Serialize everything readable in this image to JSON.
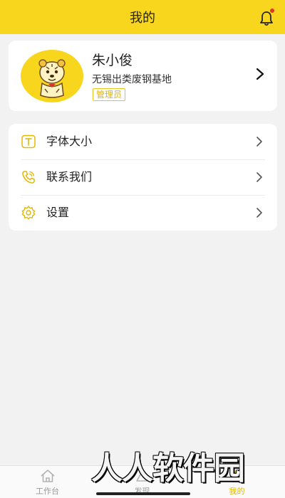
{
  "header": {
    "title": "我的",
    "bell_icon": "bell-icon",
    "accent": "#f8d61e",
    "notification_color": "#e3342f"
  },
  "profile": {
    "name": "朱小俊",
    "organization": "无锡出类废钢基地",
    "role": "管理员",
    "avatar_icon": "tiger-avatar",
    "arrow_icon": "chevron-right-icon"
  },
  "menu": {
    "items": [
      {
        "label": "字体大小",
        "icon": "font-size-icon"
      },
      {
        "label": "联系我们",
        "icon": "phone-icon"
      },
      {
        "label": "设置",
        "icon": "gear-icon"
      }
    ]
  },
  "tabbar": {
    "tabs": [
      {
        "label": "工作台",
        "icon": "home-icon",
        "active": false
      },
      {
        "label": "发现",
        "icon": "discover-icon",
        "active": false
      },
      {
        "label": "我的",
        "icon": "user-icon",
        "active": true
      }
    ],
    "active_color": "#e2b900"
  },
  "watermark": {
    "text": "人人软件园"
  }
}
